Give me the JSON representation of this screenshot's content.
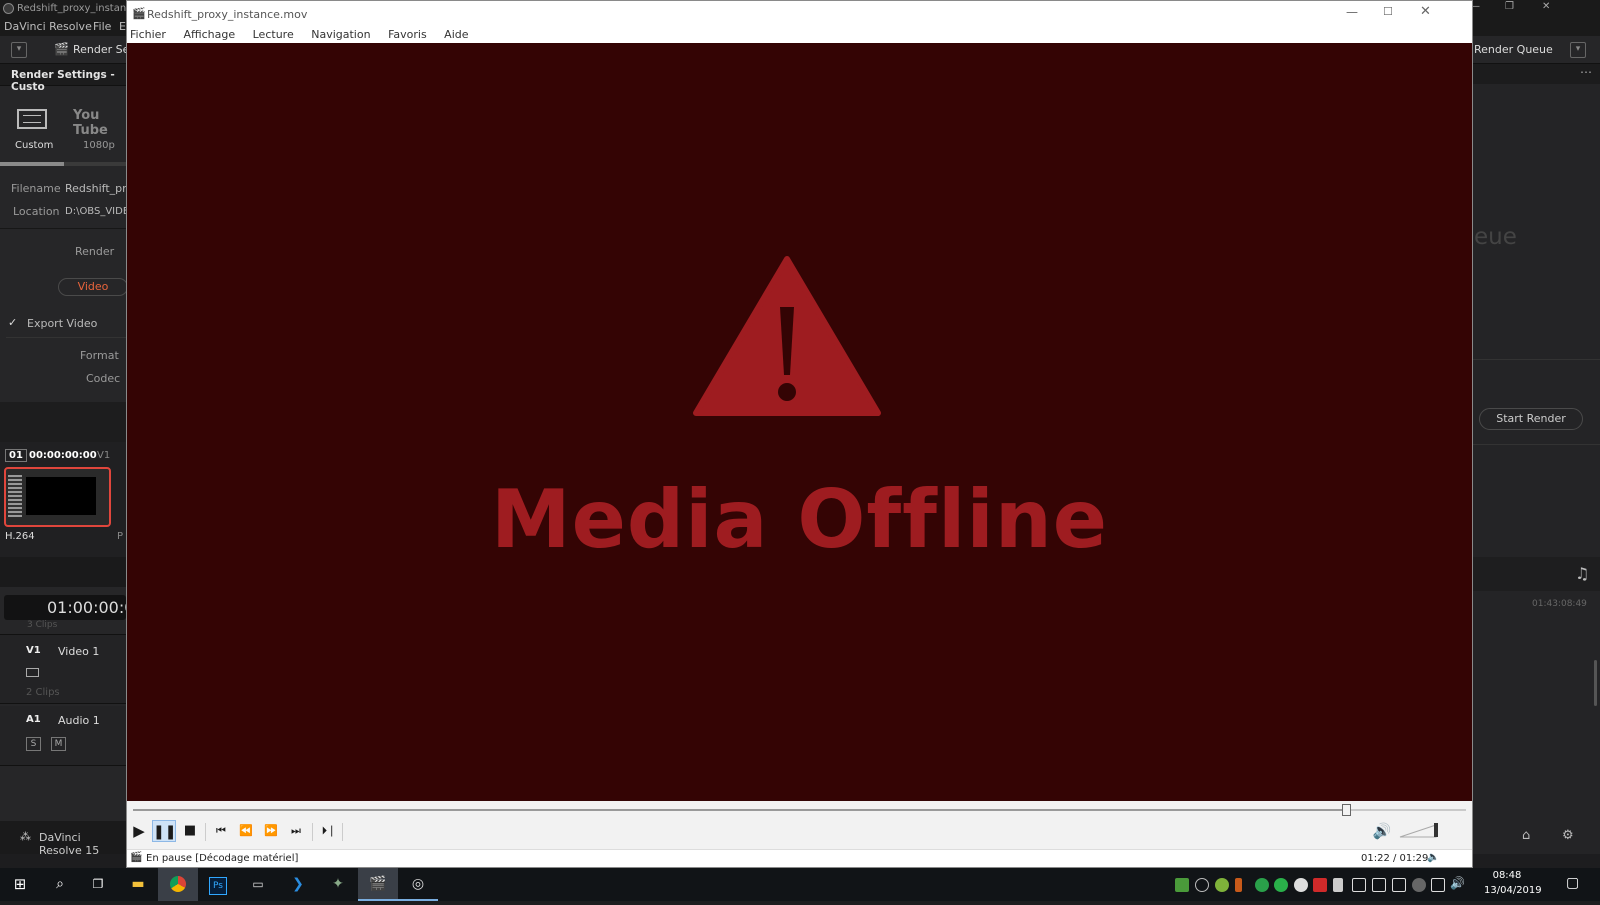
{
  "resolve": {
    "window_title": "Redshift_proxy_instance",
    "menu": [
      "DaVinci Resolve",
      "File",
      "E"
    ],
    "toolbar_render_label": "Render Se",
    "render_queue_label": "Render Queue",
    "render_settings_title": "Render Settings - Custo",
    "presets": [
      {
        "name": "Custom",
        "icon": "film-icon"
      },
      {
        "name": "1080p",
        "icon": "youtube-logo"
      }
    ],
    "youtube_logo_text": "You Tube",
    "filename_label": "Filename",
    "filename_value": "Redshift_pro",
    "location_label": "Location",
    "location_value": "D:\\OBS_VIDE",
    "render_label": "Render",
    "video_tab": "Video",
    "export_video_label": "Export Video",
    "format_label": "Format",
    "codec_label": "Codec",
    "clip_index": "01",
    "clip_timecode": "00:00:00:00",
    "clip_track": "V1",
    "clip_codec": "H.264",
    "clip_next_label": "P",
    "timeline_timecode": "01:00:00:0",
    "clips_count_top": "3 Clips",
    "v1_tag": "V1",
    "v1_name": "Video 1",
    "v1_clips": "2 Clips",
    "a1_tag": "A1",
    "a1_name": "Audio 1",
    "solo_btn": "S",
    "mute_btn": "M",
    "app_footer": "DaVinci Resolve 15",
    "queue_bg_text": "eue",
    "start_render": "Start Render",
    "right_timecode": "01:43:08:49"
  },
  "player": {
    "title": "Redshift_proxy_instance.mov",
    "menu": [
      "Fichier",
      "Affichage",
      "Lecture",
      "Navigation",
      "Favoris",
      "Aide"
    ],
    "offline_text": "Media Offline",
    "status": "En pause [Décodage matériel]",
    "time": "01:22 / 01:29",
    "progress": 0.91
  },
  "taskbar": {
    "clock_time": "08:48",
    "clock_date": "13/04/2019"
  },
  "colors": {
    "video_bg": "#340404",
    "offline_red": "#9e1c20",
    "accent_orange": "#e8643c"
  }
}
